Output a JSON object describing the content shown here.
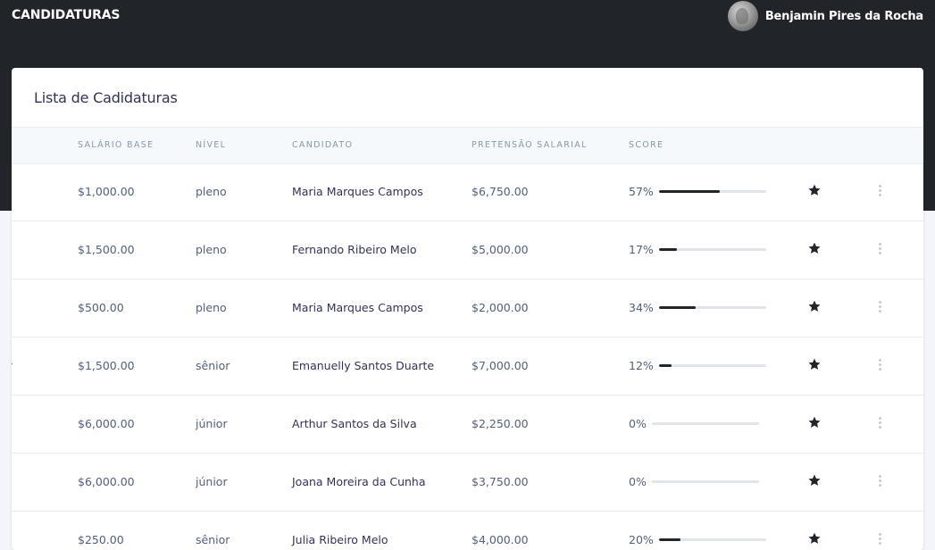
{
  "header": {
    "title": "CANDIDATURAS",
    "user_name": "Benjamin Pires da Rocha"
  },
  "card": {
    "title": "Lista de Cadidaturas"
  },
  "table": {
    "columns": [
      "SALÁRIO BASE",
      "NÍVEL",
      "CANDIDATO",
      "PRETENSÃO SALARIAL",
      "SCORE"
    ],
    "rows": [
      {
        "cut": "",
        "base": "$1,000.00",
        "level": "pleno",
        "candidate": "Maria Marques Campos",
        "pretension": "$6,750.00",
        "score": "57%",
        "score_value": 0.57
      },
      {
        "cut": "",
        "base": "$1,500.00",
        "level": "pleno",
        "candidate": "Fernando Ribeiro Melo",
        "pretension": "$5,000.00",
        "score": "17%",
        "score_value": 0.17
      },
      {
        "cut": "",
        "base": "$500.00",
        "level": "pleno",
        "candidate": "Maria Marques Campos",
        "pretension": "$2,000.00",
        "score": "34%",
        "score_value": 0.34
      },
      {
        "cut": "r",
        "base": "$1,500.00",
        "level": "sênior",
        "candidate": "Emanuelly Santos Duarte",
        "pretension": "$7,000.00",
        "score": "12%",
        "score_value": 0.12
      },
      {
        "cut": ",",
        "base": "$6,000.00",
        "level": "júnior",
        "candidate": "Arthur Santos da Silva",
        "pretension": "$2,250.00",
        "score": "0%",
        "score_value": 0
      },
      {
        "cut": ":",
        "base": "$6,000.00",
        "level": "júnior",
        "candidate": "Joana Moreira da Cunha",
        "pretension": "$3,750.00",
        "score": "0%",
        "score_value": 0
      },
      {
        "cut": "",
        "base": "$250.00",
        "level": "sênior",
        "candidate": "Julia Ribeiro Melo",
        "pretension": "$4,000.00",
        "score": "20%",
        "score_value": 0.2
      }
    ]
  },
  "icons": {
    "star": "star-icon",
    "more": "more-vertical-icon",
    "avatar": "user-avatar"
  },
  "colors": {
    "topbar": "#212529",
    "bar_fill": "#212529",
    "bar_track": "#e1e4e8",
    "text_muted": "#8898aa"
  }
}
